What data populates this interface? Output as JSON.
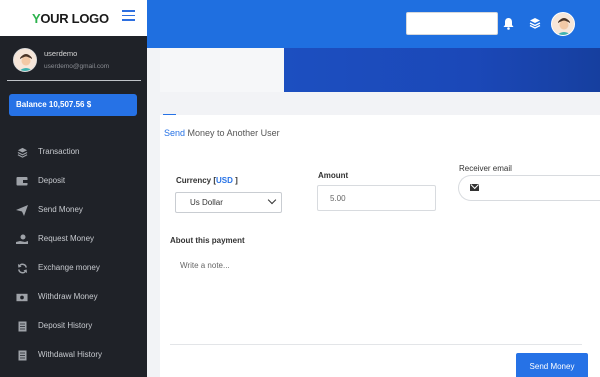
{
  "brand": {
    "logo_first": "Y",
    "logo_rest": "OUR LOGO"
  },
  "user": {
    "name": "userdemo",
    "email": "userdemo@gmail.com"
  },
  "balance_label": "Balance 10,507.56 $",
  "menu": [
    {
      "label": "Transaction",
      "icon": "layers-icon"
    },
    {
      "label": "Deposit",
      "icon": "wallet-icon"
    },
    {
      "label": "Send Money",
      "icon": "paper-plane-icon"
    },
    {
      "label": "Request Money",
      "icon": "hand-money-icon"
    },
    {
      "label": "Exchange money",
      "icon": "refresh-icon"
    },
    {
      "label": "Withdraw Money",
      "icon": "banknote-icon"
    },
    {
      "label": "Deposit History",
      "icon": "document-icon"
    },
    {
      "label": "Withdawal History",
      "icon": "document-icon"
    }
  ],
  "form": {
    "title_highlight": "Send",
    "title_rest": "Money to Another User",
    "currency_label": "Currency",
    "currency_code_open": "[",
    "currency_code": "USD",
    "currency_code_close": "]",
    "currency_selected": "Us Dollar",
    "amount_label": "Amount",
    "amount_placeholder": "5.00",
    "receiver_label": "Receiver email",
    "about_label": "About this payment",
    "note_placeholder": "Write a note...",
    "submit_label": "Send Money"
  },
  "colors": {
    "primary": "#2672e6",
    "sidebar": "#1f2228",
    "banner": "#1c4fc0"
  }
}
